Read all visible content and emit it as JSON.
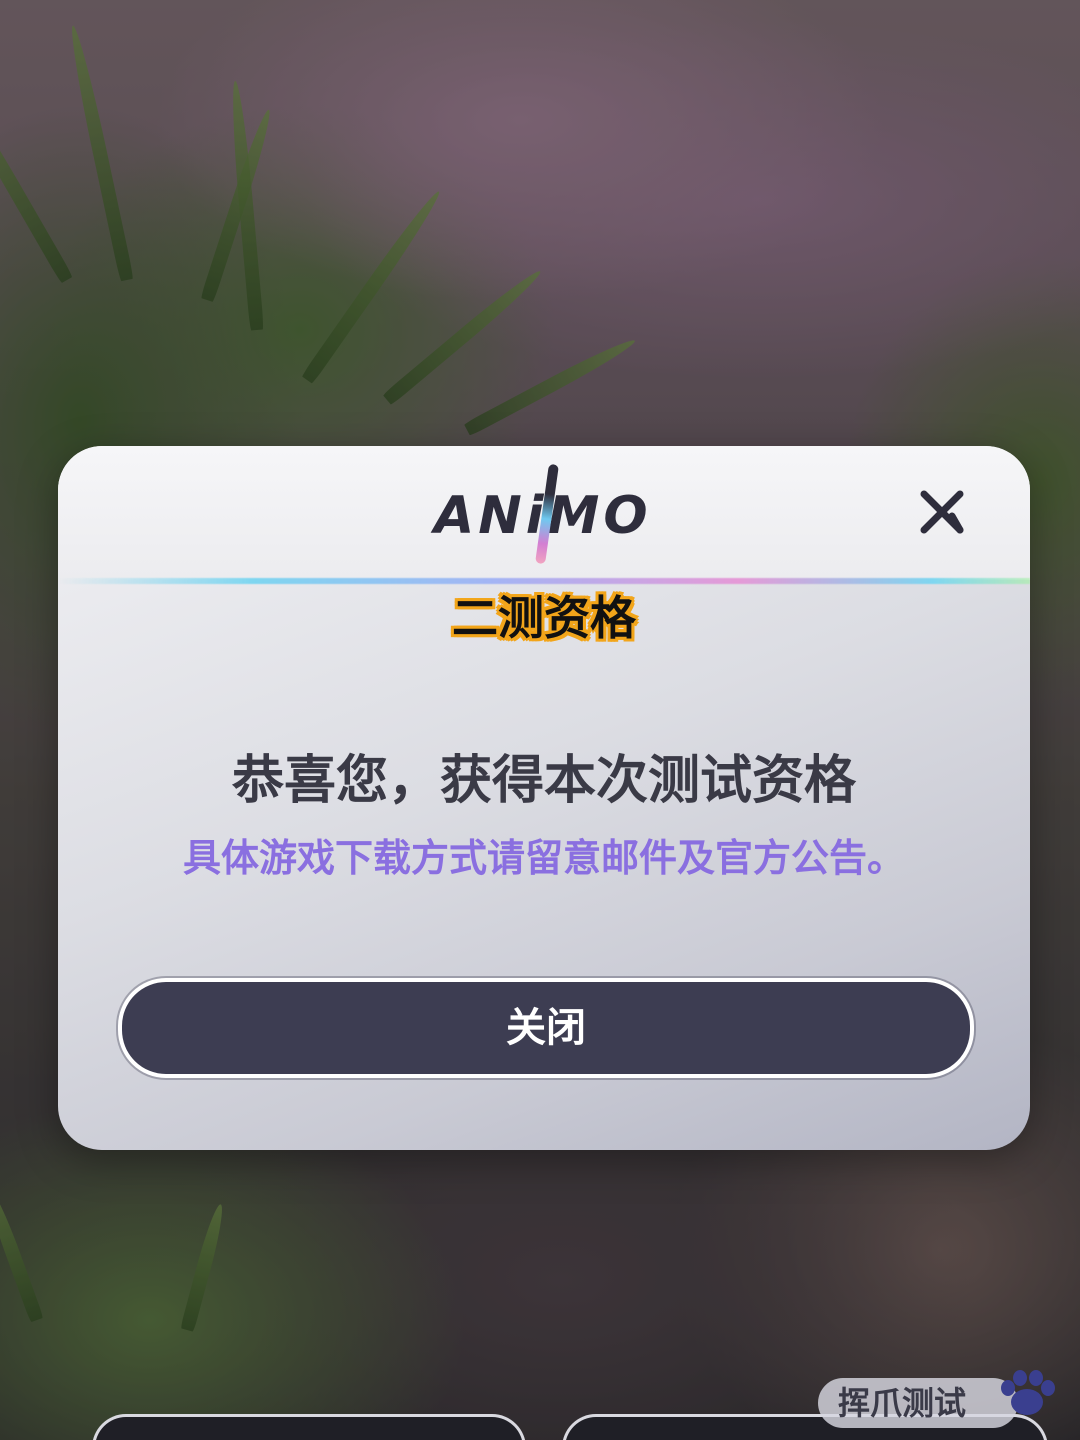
{
  "dialog": {
    "logo_text": "ANiMO",
    "title": "二测资格",
    "message": "恭喜您，获得本次测试资格",
    "sub_message": "具体游戏下载方式请留意邮件及官方公告。",
    "close_button_label": "关闭",
    "close_icon": "close-icon"
  },
  "watermark": {
    "text": "挥爪测试",
    "icon": "paw-icon"
  },
  "colors": {
    "accent_purple": "#8a6fe0",
    "button_dark": "#3d3d52",
    "title_highlight": "#f2a51a"
  }
}
